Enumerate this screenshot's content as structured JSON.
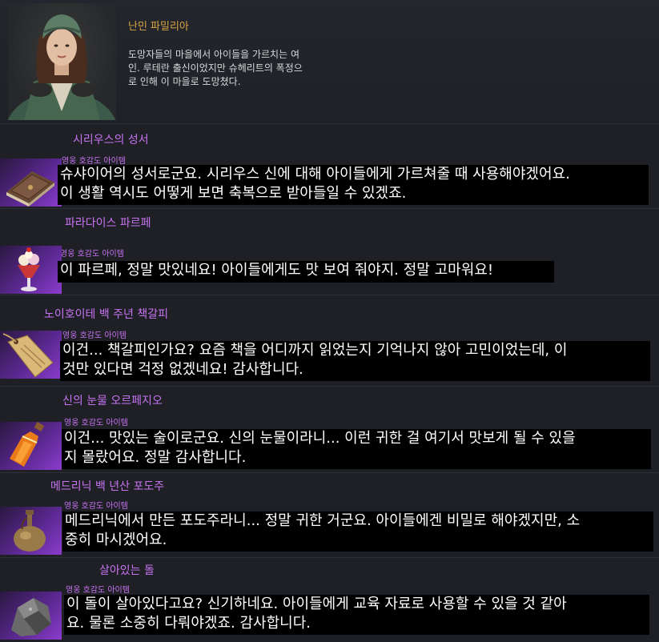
{
  "npc": {
    "name": "난민 파밀리아",
    "description_lines": [
      "도망자들의 마을에서 아이들을 가르치는 여",
      "인. 루테란 출신이었지만 슈헤리트의 폭정으",
      "로 인해 이 마을로 도망쳤다."
    ]
  },
  "items": [
    {
      "title": "시리우스의 성서",
      "tag": "영웅 호감도 아이템",
      "icon": "book-icon",
      "dialogue": [
        "슈샤이어의 성서로군요. 시리우스 신에 대해 아이들에게 가르쳐줄 때 사용해야겠어요.",
        "이 생활 역시도 어떻게 보면 축복으로 받아들일 수 있겠죠."
      ]
    },
    {
      "title": "파라다이스 파르페",
      "tag": "영웅 호감도 아이템",
      "icon": "parfait-icon",
      "dialogue": [
        "이 파르페, 정말 맛있네요! 아이들에게도 맛 보여 줘야지. 정말 고마워요!"
      ]
    },
    {
      "title": "노이호이테 백 주년 책갈피",
      "tag": "영웅 호감도 아이템",
      "icon": "bookmark-tag-icon",
      "dialogue": [
        "이건... 책갈피인가요? 요즘 책을 어디까지 읽었는지 기억나지 않아 고민이었는데, 이",
        "것만 있다면 걱정 없겠네요! 감사합니다."
      ]
    },
    {
      "title": "신의 눈물 오르페지오",
      "tag": "영웅 호감도 아이템",
      "icon": "liquor-bottle-icon",
      "dialogue": [
        "이건... 맛있는 술이로군요. 신의 눈물이라니... 이런 귀한 걸 여기서 맛보게 될 수 있을",
        "지 몰랐어요. 정말 감사합니다."
      ]
    },
    {
      "title": "메드리닉 백 년산 포도주",
      "tag": "영웅 호감도 아이템",
      "icon": "wine-flask-icon",
      "dialogue": [
        "메드리닉에서 만든 포도주라니... 정말 귀한 거군요. 아이들에겐 비밀로 해야겠지만, 소",
        "중히 마시겠어요."
      ]
    },
    {
      "title": "살아있는 돌",
      "tag": "영웅 호감도 아이템",
      "icon": "stone-icon",
      "dialogue": [
        "이 돌이 살아있다고요? 신기하네요. 아이들에게 교육 자료로 사용할 수 있을 것 같아",
        "요. 물론 소중히 다뤄야겠죠. 감사합니다."
      ]
    }
  ]
}
